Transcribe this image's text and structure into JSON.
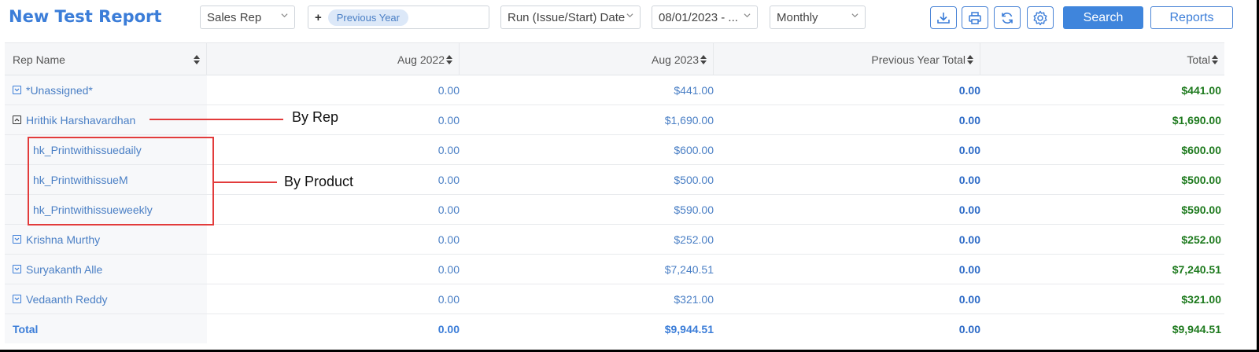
{
  "toolbar": {
    "title": "New Test Report",
    "group_by": "Sales Rep",
    "compare_plus": "+",
    "compare_chip": "Previous Year",
    "date_field": "Run (Issue/Start) Date",
    "date_range": "08/01/2023 - ...",
    "period": "Monthly",
    "search_label": "Search",
    "reports_label": "Reports",
    "icons": [
      "download-icon",
      "print-icon",
      "refresh-icon",
      "gear-icon"
    ]
  },
  "table": {
    "columns": [
      "Rep Name",
      "Aug 2022",
      "Aug 2023",
      "Previous Year Total",
      "Total"
    ],
    "rows": [
      {
        "name": "*Unassigned*",
        "aug2022": "0.00",
        "aug2023": "$441.00",
        "prev_total": "0.00",
        "total": "$441.00",
        "level": "rep",
        "expanded": false
      },
      {
        "name": "Hrithik Harshavardhan",
        "aug2022": "0.00",
        "aug2023": "$1,690.00",
        "prev_total": "0.00",
        "total": "$1,690.00",
        "level": "rep",
        "expanded": true
      },
      {
        "name": "hk_Printwithissuedaily",
        "aug2022": "0.00",
        "aug2023": "$600.00",
        "prev_total": "0.00",
        "total": "$600.00",
        "level": "product"
      },
      {
        "name": "hk_PrintwithissueM",
        "aug2022": "0.00",
        "aug2023": "$500.00",
        "prev_total": "0.00",
        "total": "$500.00",
        "level": "product"
      },
      {
        "name": "hk_Printwithissueweekly",
        "aug2022": "0.00",
        "aug2023": "$590.00",
        "prev_total": "0.00",
        "total": "$590.00",
        "level": "product"
      },
      {
        "name": "Krishna Murthy",
        "aug2022": "0.00",
        "aug2023": "$252.00",
        "prev_total": "0.00",
        "total": "$252.00",
        "level": "rep",
        "expanded": false
      },
      {
        "name": "Suryakanth Alle",
        "aug2022": "0.00",
        "aug2023": "$7,240.51",
        "prev_total": "0.00",
        "total": "$7,240.51",
        "level": "rep",
        "expanded": false
      },
      {
        "name": "Vedaanth Reddy",
        "aug2022": "0.00",
        "aug2023": "$321.00",
        "prev_total": "0.00",
        "total": "$321.00",
        "level": "rep",
        "expanded": false
      }
    ],
    "total": {
      "name": "Total",
      "aug2022": "0.00",
      "aug2023": "$9,944.51",
      "prev_total": "0.00",
      "total": "$9,944.51"
    }
  },
  "annotations": {
    "by_rep": "By Rep",
    "by_product": "By Product"
  },
  "colors": {
    "accent": "#3b7dd8",
    "total_green": "#1e7a1e",
    "annotation_red": "#e23b3b"
  }
}
